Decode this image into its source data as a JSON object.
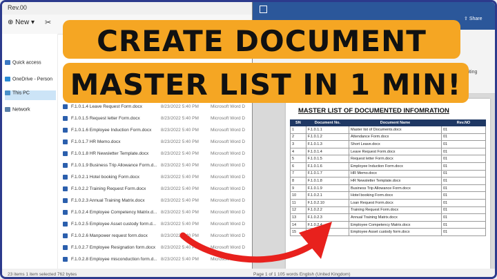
{
  "explorer": {
    "title": "Rev.00",
    "new_label": "New",
    "nav": [
      {
        "label": "Quick access",
        "color": "#3b78c4"
      },
      {
        "label": "OneDrive - Person",
        "color": "#2a8ad4"
      },
      {
        "label": "This PC",
        "color": "#4a90c9"
      },
      {
        "label": "Network",
        "color": "#5a7fa8"
      }
    ],
    "files": [
      {
        "name": "F.1.0.1.4 Leave Request Form.docx",
        "date": "8/23/2022 5:40 PM",
        "type": "Microsoft Word D"
      },
      {
        "name": "F.1.0.1.5 Request letter Form.docx",
        "date": "8/23/2022 5:40 PM",
        "type": "Microsoft Word D"
      },
      {
        "name": "F.1.0.1.6 Employee Induction Form.docx",
        "date": "8/23/2022 5:40 PM",
        "type": "Microsoft Word D"
      },
      {
        "name": "F.1.0.1.7 HR Memo.docx",
        "date": "8/23/2022 5:40 PM",
        "type": "Microsoft Word D"
      },
      {
        "name": "F.1.0.1.8 HR Newsletter Template.docx",
        "date": "8/23/2022 5:40 PM",
        "type": "Microsoft Word D"
      },
      {
        "name": "F.1.0.1.9 Business Trip Allowance Form.d...",
        "date": "8/23/2022 5:40 PM",
        "type": "Microsoft Word D"
      },
      {
        "name": "F.1.0.2.1 Hotel booking Form.docx",
        "date": "8/23/2022 5:40 PM",
        "type": "Microsoft Word D"
      },
      {
        "name": "F.1.0.2.2 Training Request Form.docx",
        "date": "8/23/2022 5:40 PM",
        "type": "Microsoft Word D"
      },
      {
        "name": "F.1.0.2.3 Annual Training Matrix.docx",
        "date": "8/23/2022 5:40 PM",
        "type": "Microsoft Word D"
      },
      {
        "name": "F.1.0.2.4 Employee Competency Matrix.d...",
        "date": "8/23/2022 5:40 PM",
        "type": "Microsoft Word D"
      },
      {
        "name": "F.1.0.2.5 Employee Asset custody form.d...",
        "date": "8/23/2022 5:40 PM",
        "type": "Microsoft Word D"
      },
      {
        "name": "F.1.0.2.6 Manpower request form.docx",
        "date": "8/23/2022 5:40 PM",
        "type": "Microsoft Word D"
      },
      {
        "name": "F.1.0.2.7 Employee Resignation form.docx",
        "date": "8/23/2022 5:40 PM",
        "type": "Microsoft Word D"
      },
      {
        "name": "F.1.0.2.8 Employee misconduction form.d...",
        "date": "8/23/2022 5:40 PM",
        "type": "Microsoft Word D"
      }
    ],
    "status": "23 items   1 item selected  762 bytes"
  },
  "word": {
    "share_label": "Share",
    "editing_label": "Editing",
    "status": "Page 1 of 1    105 words    English (United Kingdom)",
    "doc_title": "MASTER LIST OF DOCUMENTED INFOMRATION",
    "headers": [
      "SN",
      "Document No.",
      "Document Name",
      "Rev.NO"
    ],
    "rows": [
      {
        "sn": "1",
        "no": "F.1.0.1.1",
        "name": "Master list of Documents.docx",
        "rev": "01"
      },
      {
        "sn": "2",
        "no": "F.1.0.1.2",
        "name": "Attendance Form.docx",
        "rev": "01"
      },
      {
        "sn": "3",
        "no": "F.1.0.1.3",
        "name": "Short Leave.docx",
        "rev": "01"
      },
      {
        "sn": "4",
        "no": "F.1.0.1.4",
        "name": "Leave Request Form.docx",
        "rev": "01"
      },
      {
        "sn": "5",
        "no": "F.1.0.1.5",
        "name": "Request letter Form.docx",
        "rev": "01"
      },
      {
        "sn": "6",
        "no": "F.1.0.1.6",
        "name": "Employee Induction Form.docx",
        "rev": "01"
      },
      {
        "sn": "7",
        "no": "F.1.0.1.7",
        "name": "HR Memo.docx",
        "rev": "01"
      },
      {
        "sn": "8",
        "no": "F.1.0.1.8",
        "name": "HR Newsletter Template.docx",
        "rev": "01"
      },
      {
        "sn": "9",
        "no": "F.1.0.1.9",
        "name": "Business Trip Allowance Form.docx",
        "rev": "01"
      },
      {
        "sn": "10",
        "no": "F.1.0.2.1",
        "name": "Hotel booking Form.docx",
        "rev": "01"
      },
      {
        "sn": "11",
        "no": "F.1.0.2.10",
        "name": "Loan Request Form.docx",
        "rev": "01"
      },
      {
        "sn": "12",
        "no": "F.1.0.2.2",
        "name": "Training Request Form.docx",
        "rev": "01"
      },
      {
        "sn": "13",
        "no": "F.1.0.2.3",
        "name": "Annual Training Matrix.docx",
        "rev": "01"
      },
      {
        "sn": "14",
        "no": "F.1.0.2.4",
        "name": "Employee Competency Matrix.docx",
        "rev": "01"
      },
      {
        "sn": "15",
        "no": "F.1.0.2.5",
        "name": "Employee Asset custody form.docx",
        "rev": "01"
      }
    ]
  },
  "banner": {
    "line1": "CREATE DOCUMENT",
    "line2": "MASTER LIST IN 1 MIN!",
    "color": "#f5a623"
  },
  "colors": {
    "arrow": "#e8211d",
    "word_blue": "#2b579a",
    "table_header": "#1f3864"
  },
  "icons": {
    "arrow": "curved-red-arrow-icon"
  }
}
